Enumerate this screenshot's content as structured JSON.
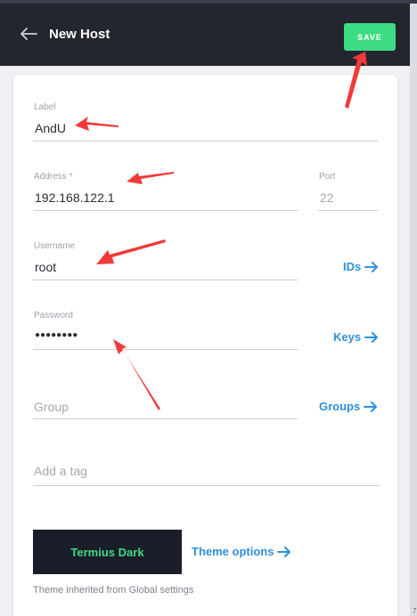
{
  "header": {
    "title": "New Host",
    "save_label": "SAVE"
  },
  "form": {
    "label": {
      "caption": "Label",
      "value": "AndU"
    },
    "address": {
      "caption": "Address *",
      "value": "192.168.122.1"
    },
    "port": {
      "caption": "Port",
      "value": "22"
    },
    "username": {
      "caption": "Username",
      "value": "root"
    },
    "password": {
      "caption": "Password",
      "value": "●●●●●●●●"
    },
    "group": {
      "placeholder": "Group"
    },
    "tag": {
      "placeholder": "Add a tag"
    }
  },
  "links": {
    "ids": "IDs",
    "keys": "Keys",
    "groups": "Groups",
    "theme_options": "Theme options"
  },
  "theme": {
    "name": "Termius Dark",
    "note": "Theme inherited from Global settings"
  },
  "corner_mark": "7",
  "colors": {
    "header_bg": "#23252f",
    "accent_green": "#3ddc84",
    "link_blue": "#2f8fdd",
    "annotation_red": "#f03a3a",
    "theme_bg": "#1a1d2a"
  }
}
